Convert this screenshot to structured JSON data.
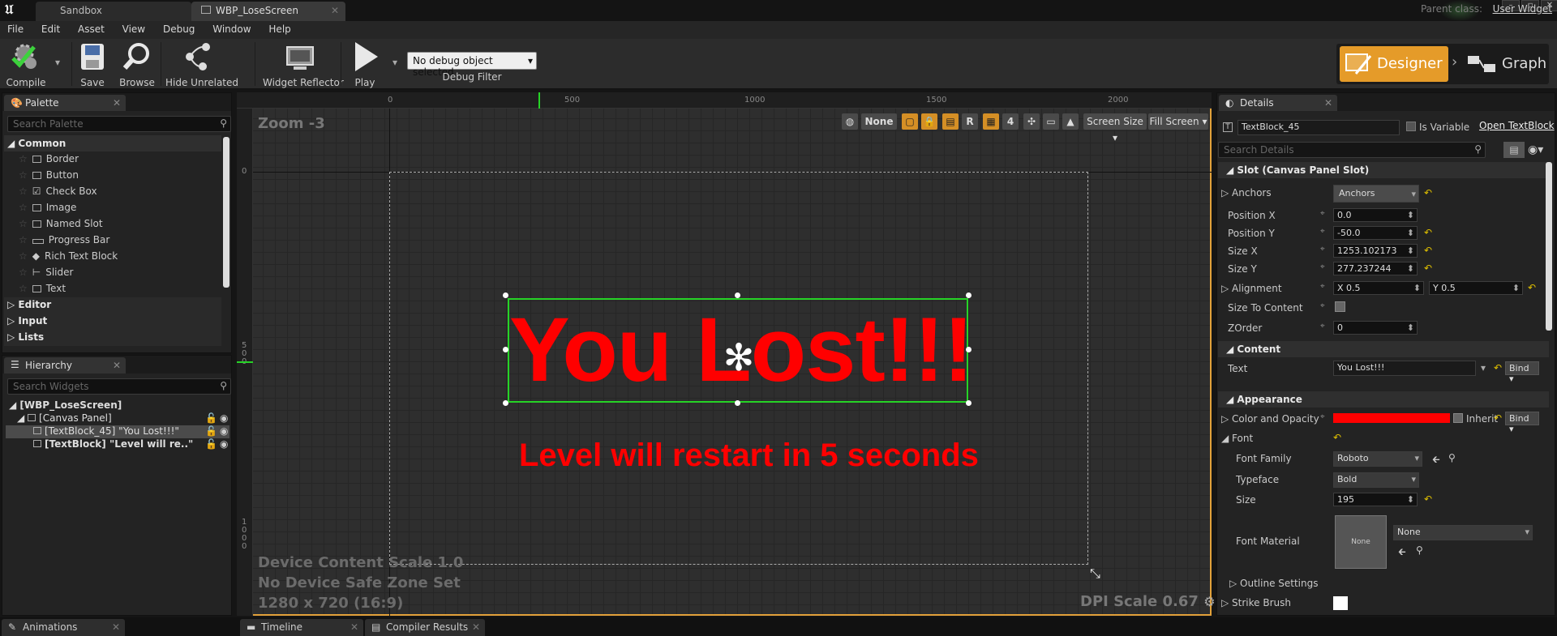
{
  "tabs": [
    {
      "label": "Sandbox"
    },
    {
      "label": "WBP_LoseScreen"
    }
  ],
  "parent_class": {
    "label": "Parent class:",
    "value": "User Widget"
  },
  "menu": [
    "File",
    "Edit",
    "Asset",
    "View",
    "Debug",
    "Window",
    "Help"
  ],
  "toolbar": {
    "compile": "Compile",
    "save": "Save",
    "browse": "Browse",
    "hide_unrelated": "Hide Unrelated",
    "widget_reflector": "Widget Reflector",
    "play": "Play",
    "debug_selected": "No debug object selected",
    "debug_filter": "Debug Filter"
  },
  "mode": {
    "designer": "Designer",
    "graph": "Graph"
  },
  "palette": {
    "tab": "Palette",
    "search_placeholder": "Search Palette",
    "common": "Common",
    "items": [
      "Border",
      "Button",
      "Check Box",
      "Image",
      "Named Slot",
      "Progress Bar",
      "Rich Text Block",
      "Slider",
      "Text"
    ],
    "categories": [
      "Editor",
      "Input",
      "Lists"
    ]
  },
  "hierarchy": {
    "tab": "Hierarchy",
    "search_placeholder": "Search Widgets",
    "root": "[WBP_LoseScreen]",
    "canvas": "[Canvas Panel]",
    "item1": "[TextBlock_45] \"You Lost!!!\"",
    "item2": "[TextBlock] \"Level will re..\""
  },
  "viewport": {
    "zoom": "Zoom -3",
    "ruler_top": [
      "0",
      "500",
      "1000",
      "1500",
      "2000"
    ],
    "ruler_left": [
      "0",
      "5\n0\n0",
      "1\n0\n0\n0"
    ],
    "toolbar": {
      "none": "None",
      "r": "R",
      "grid": "4",
      "screen_size": "Screen Size",
      "fill_screen": "Fill Screen"
    },
    "lost_text": "You Lost!!!",
    "restart_text": "Level will restart in 5 seconds",
    "info": [
      "Device Content Scale 1.0",
      "No Device Safe Zone Set",
      "1280 x 720 (16:9)"
    ],
    "dpi": "DPI Scale 0.67"
  },
  "details": {
    "tab": "Details",
    "name": "TextBlock_45",
    "is_variable": "Is Variable",
    "open_link": "Open TextBlock",
    "search_placeholder": "Search Details",
    "slot_section": "Slot (Canvas Panel Slot)",
    "anchors_label": "Anchors",
    "anchors_value": "Anchors",
    "position_x_label": "Position X",
    "position_x": "0.0",
    "position_y_label": "Position Y",
    "position_y": "-50.0",
    "size_x_label": "Size X",
    "size_x": "1253.102173",
    "size_y_label": "Size Y",
    "size_y": "277.237244",
    "alignment_label": "Alignment",
    "alignment_x": "X  0.5",
    "alignment_y": "Y  0.5",
    "size_to_content_label": "Size To Content",
    "zorder_label": "ZOrder",
    "zorder": "0",
    "content_section": "Content",
    "text_label": "Text",
    "text_value": "You Lost!!!",
    "bind": "Bind",
    "appearance_section": "Appearance",
    "color_label": "Color and Opacity",
    "inherit": "Inherit",
    "color_value": "#ff0000",
    "font_label": "Font",
    "font_family_label": "Font Family",
    "font_family": "Roboto",
    "typeface_label": "Typeface",
    "typeface": "Bold",
    "size_label": "Size",
    "size": "195",
    "font_material_label": "Font Material",
    "font_material": "None",
    "font_material_thumb": "None",
    "outline_label": "Outline Settings",
    "strike_label": "Strike Brush"
  },
  "bottom_tabs": [
    "Animations",
    "Timeline",
    "Compiler Results"
  ],
  "colors": {
    "accent": "#e59b29",
    "text_red": "#ff0000",
    "selection": "#26d326"
  }
}
